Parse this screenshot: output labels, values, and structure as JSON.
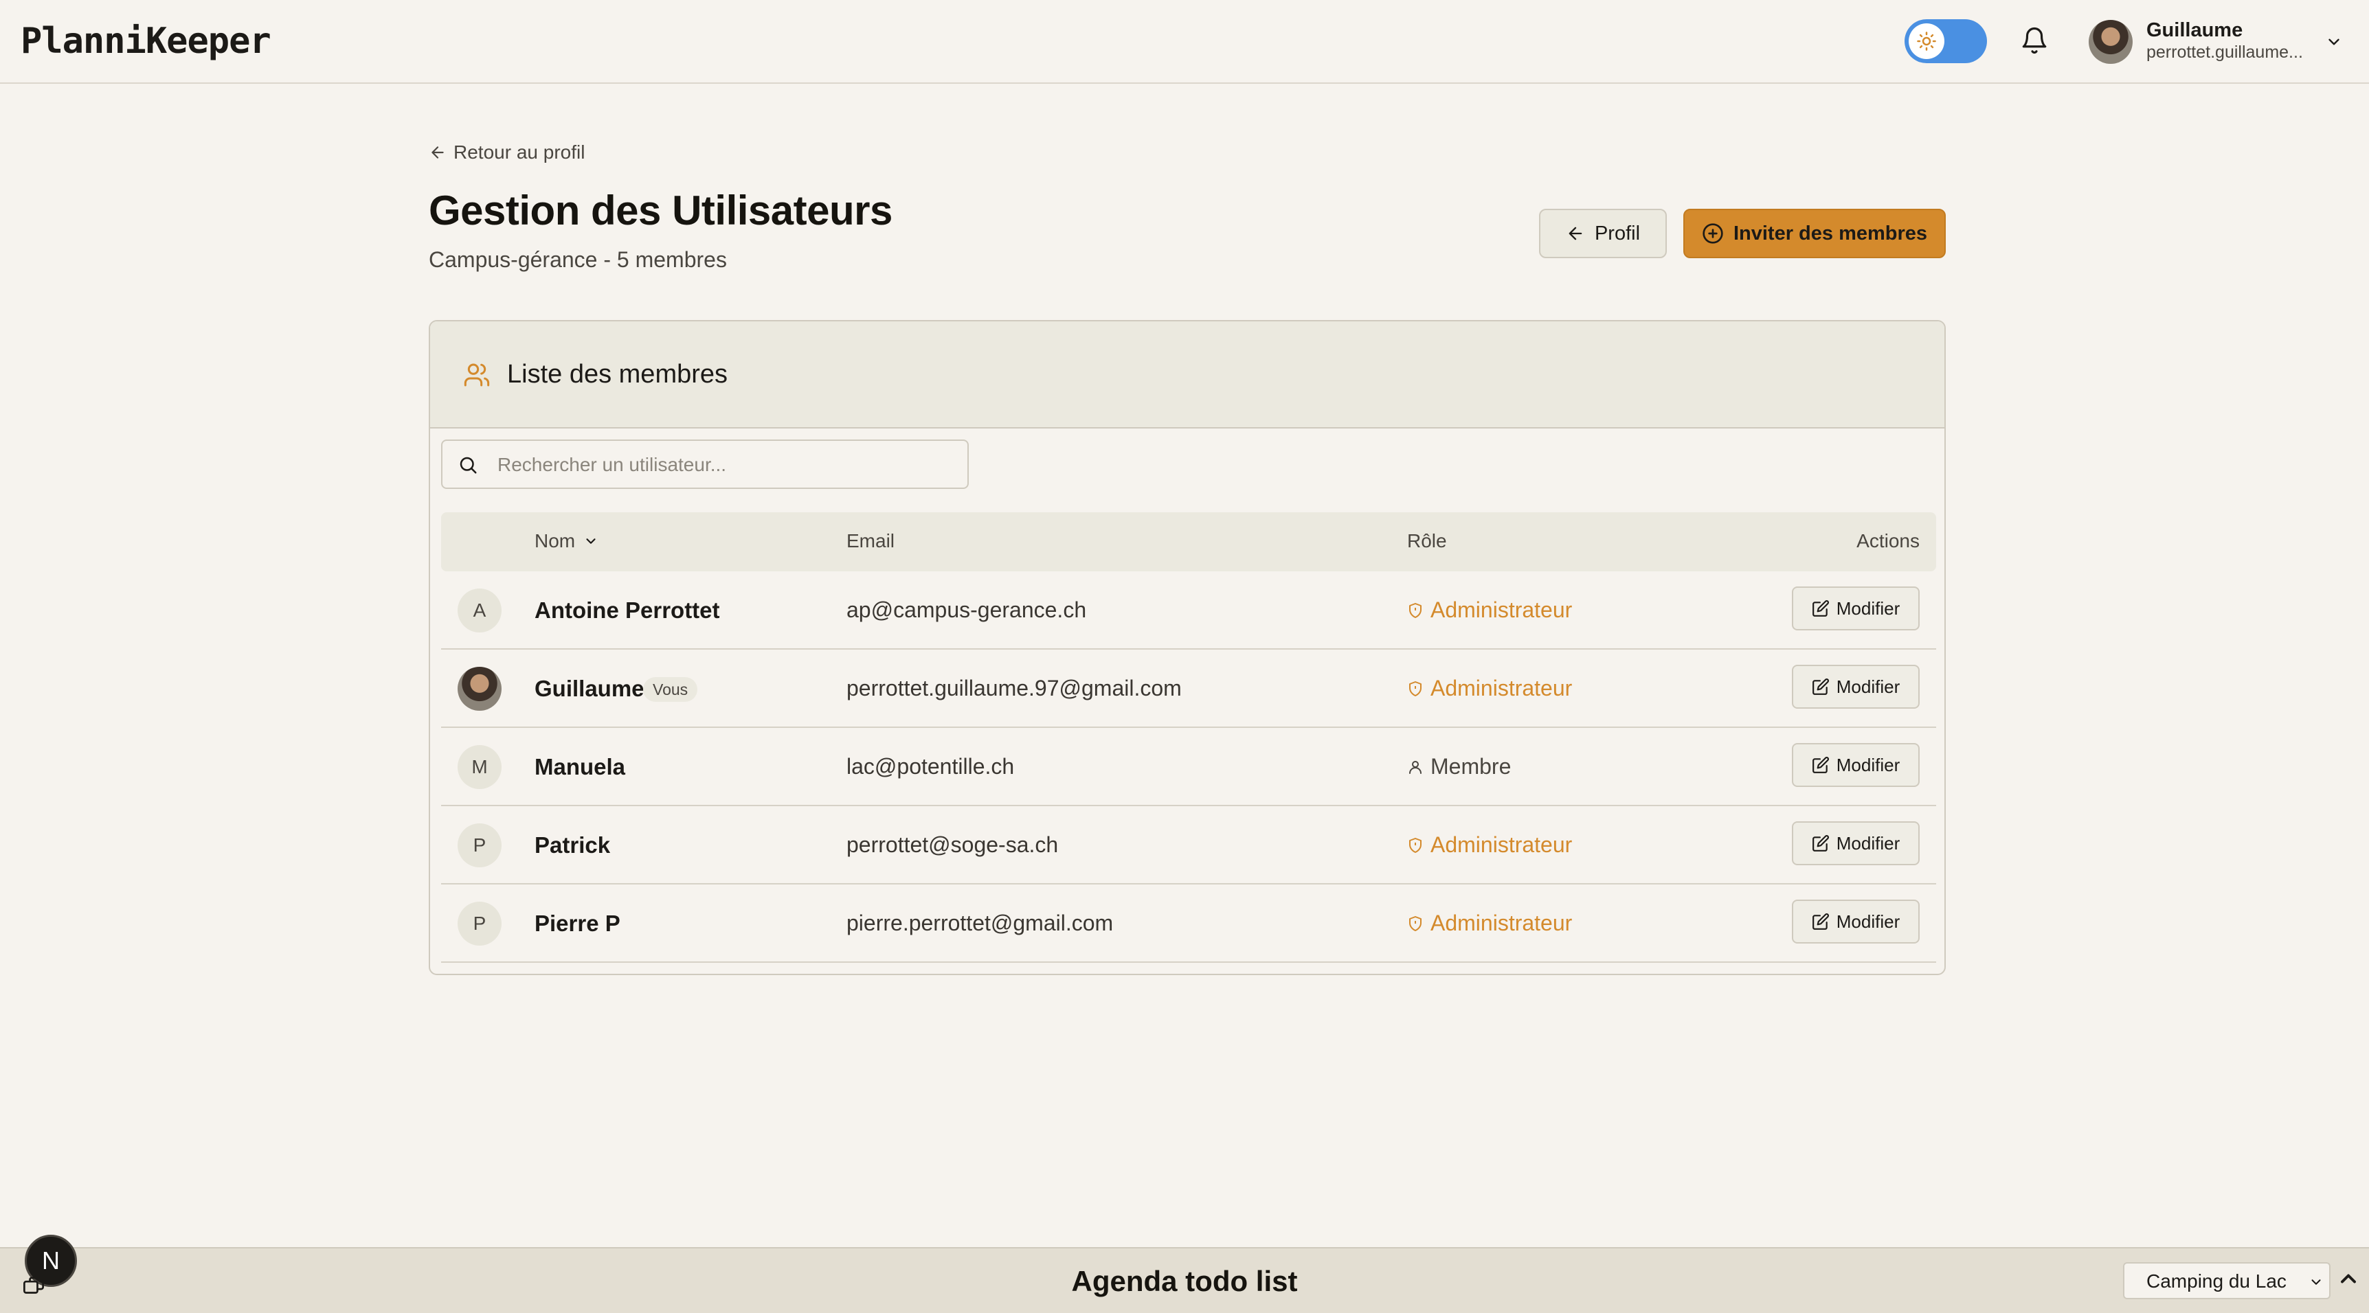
{
  "app": {
    "logo": "PlanniKeeper"
  },
  "topbar": {
    "user": {
      "name": "Guillaume",
      "email": "perrottet.guillaume..."
    }
  },
  "header": {
    "back_link": "Retour au profil",
    "title": "Gestion des Utilisateurs",
    "subtitle": "Campus-gérance - 5 membres",
    "profil_button": "Profil",
    "invite_button": "Inviter des membres"
  },
  "card": {
    "title": "Liste des membres",
    "search_placeholder": "Rechercher un utilisateur...",
    "columns": {
      "name": "Nom",
      "email": "Email",
      "role": "Rôle",
      "actions": "Actions"
    },
    "you_badge": "Vous",
    "edit_label": "Modifier",
    "members": [
      {
        "initial": "A",
        "name": "Antoine Perrottet",
        "email": "ap@campus-gerance.ch",
        "role": "Administrateur",
        "role_type": "admin"
      },
      {
        "initial": "",
        "name": "Guillaume",
        "email": "perrottet.guillaume.97@gmail.com",
        "role": "Administrateur",
        "role_type": "admin",
        "is_current_user": true
      },
      {
        "initial": "M",
        "name": "Manuela",
        "email": "lac@potentille.ch",
        "role": "Membre",
        "role_type": "member"
      },
      {
        "initial": "P",
        "name": "Patrick",
        "email": "perrottet@soge-sa.ch",
        "role": "Administrateur",
        "role_type": "admin"
      },
      {
        "initial": "P",
        "name": "Pierre P",
        "email": "pierre.perrottet@gmail.com",
        "role": "Administrateur",
        "role_type": "admin"
      }
    ]
  },
  "bottombar": {
    "title": "Agenda todo list",
    "site_select": "Camping du Lac",
    "dev_badge": "N"
  },
  "colors": {
    "background": "#f6f3ee",
    "accent": "#d48a2c",
    "toggle": "#4a90e2",
    "panel": "#ebe9df"
  },
  "icons": {
    "theme": "sun-icon",
    "notifications": "bell-icon",
    "user_menu": "chevron-down-icon",
    "back": "arrow-left-icon",
    "invite": "plus-circle-icon",
    "members": "users-icon",
    "search": "search-icon",
    "sort": "chevron-down-icon",
    "admin_role": "shield-icon",
    "member_role": "user-icon",
    "edit": "edit-icon"
  }
}
